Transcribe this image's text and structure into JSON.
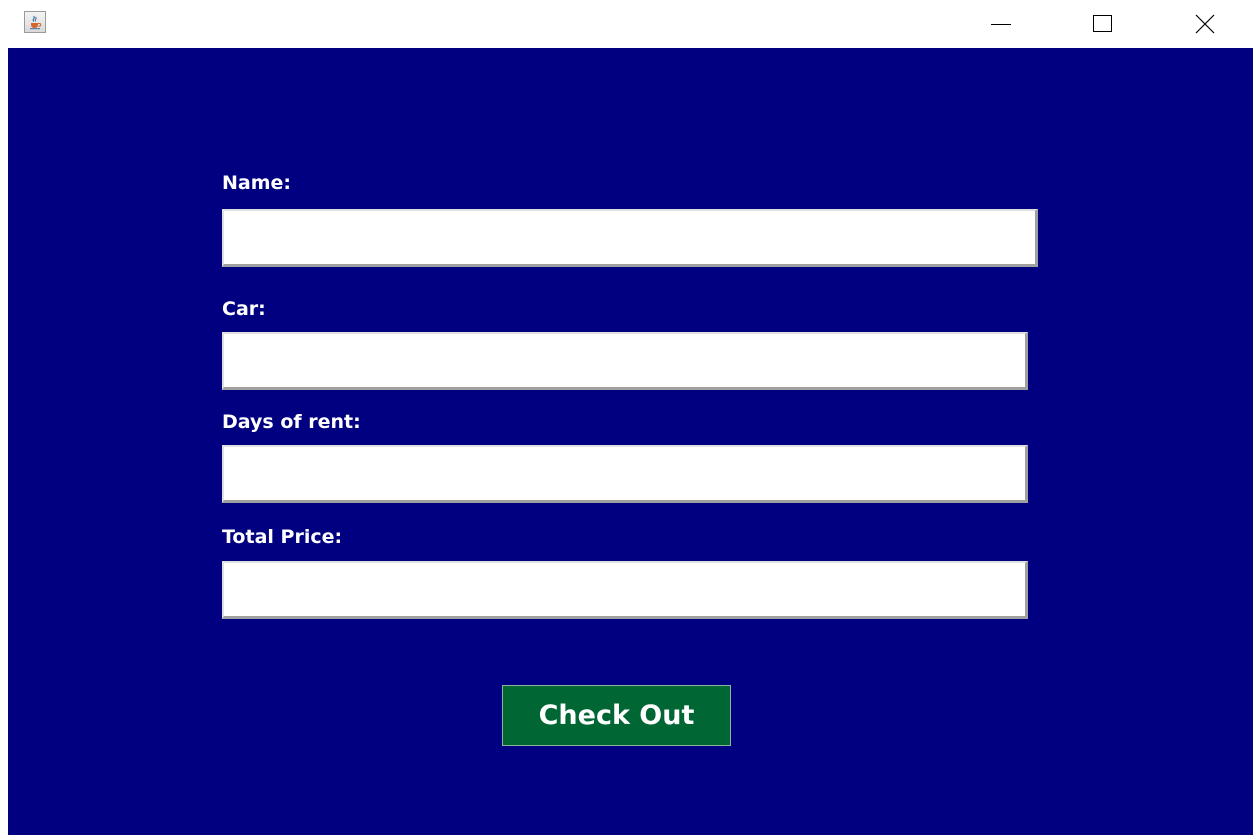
{
  "window": {
    "icon": "java-cup-icon",
    "controls": {
      "minimize": "minimize-icon",
      "maximize": "maximize-icon",
      "close": "close-icon"
    }
  },
  "form": {
    "background_color": "#000080",
    "fields": [
      {
        "label": "Name:",
        "value": "",
        "placeholder": ""
      },
      {
        "label": "Car:",
        "value": "",
        "placeholder": ""
      },
      {
        "label": "Days of rent:",
        "value": "",
        "placeholder": ""
      },
      {
        "label": "Total Price:",
        "value": "",
        "placeholder": ""
      }
    ],
    "checkout_button": {
      "label": "Check Out",
      "color": "#006633"
    }
  }
}
